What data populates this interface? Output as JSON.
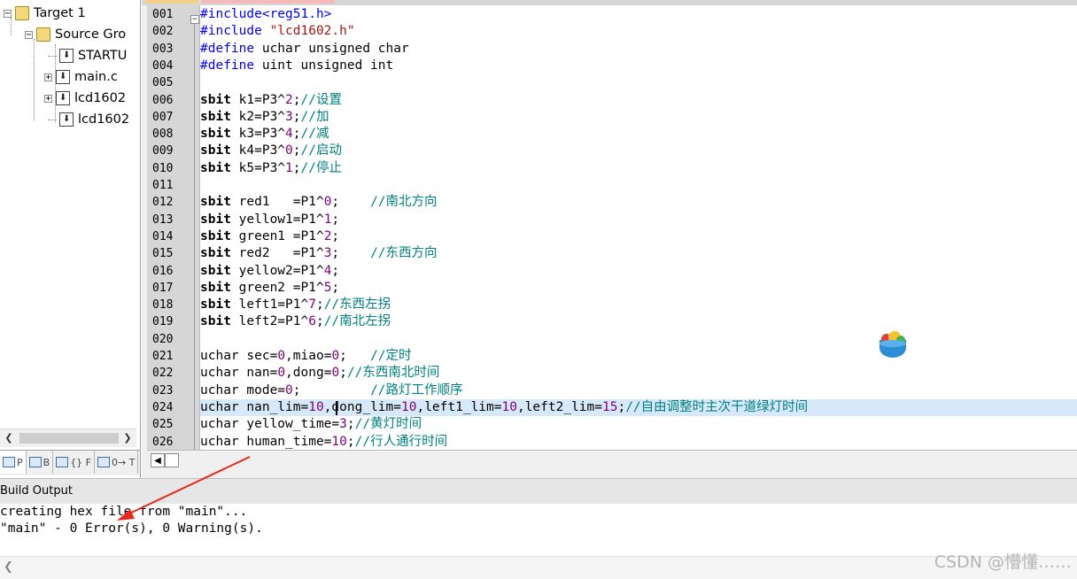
{
  "project": {
    "tree": [
      {
        "label": "Target 1",
        "expander": "−",
        "icon": "target-folder-icon"
      },
      {
        "label": "Source Gro",
        "expander": "−",
        "icon": "folder-icon"
      },
      {
        "label": "STARTU",
        "icon": "file-icon"
      },
      {
        "label": "main.c",
        "expander": "+",
        "icon": "file-icon"
      },
      {
        "label": "lcd1602",
        "expander": "+",
        "icon": "file-icon"
      },
      {
        "label": "lcd1602",
        "icon": "file-icon"
      }
    ],
    "tabs": [
      {
        "label": "P",
        "icon": "project-tab-icon"
      },
      {
        "label": "B",
        "icon": "books-tab-icon"
      },
      {
        "label": "{} F",
        "icon": "functions-tab-icon"
      },
      {
        "label": "0→ T",
        "icon": "templates-tab-icon"
      }
    ]
  },
  "editor": {
    "line_numbers": [
      "001",
      "002",
      "003",
      "004",
      "005",
      "006",
      "007",
      "008",
      "009",
      "010",
      "011",
      "012",
      "013",
      "014",
      "015",
      "016",
      "017",
      "018",
      "019",
      "020",
      "021",
      "022",
      "023",
      "024",
      "025",
      "026"
    ],
    "lines": [
      "#include<reg51.h>",
      "#include \"lcd1602.h\"",
      "#define uchar unsigned char",
      "#define uint unsigned int",
      "",
      "sbit k1=P3^2;//设置",
      "sbit k2=P3^3;//加",
      "sbit k3=P3^4;//减",
      "sbit k4=P3^0;//启动",
      "sbit k5=P3^1;//停止",
      "",
      "sbit red1   =P1^0;    //南北方向",
      "sbit yellow1=P1^1;",
      "sbit green1 =P1^2;",
      "sbit red2   =P1^3;    //东西方向",
      "sbit yellow2=P1^4;",
      "sbit green2 =P1^5;",
      "sbit left1=P1^7;//东西左拐",
      "sbit left2=P1^6;//南北左拐",
      "",
      "uchar sec=0,miao=0;   //定时",
      "uchar nan=0,dong=0;//东西南北时间",
      "uchar mode=0;         //路灯工作顺序",
      "uchar nan_lim=10,dong_lim=10,left1_lim=10,left2_lim=15;//自由调整时主次干道绿灯时间",
      "uchar yellow_time=3;//黄灯时间",
      "uchar human_time=10;//行人通行时间"
    ],
    "highlight_line": "024"
  },
  "build": {
    "title": "Build Output",
    "lines": [
      "creating hex file from \"main\"...",
      "\"main\" - 0 Error(s), 0 Warning(s)."
    ]
  },
  "watermark": "CSDN @懵懂……",
  "colors": {
    "keyword": "#000000",
    "preprocessor": "#0000ff",
    "number": "#7f007f",
    "string": "#a31515",
    "comment": "#008080",
    "arrow": "#e8281c",
    "highlight": "#d7e9f8"
  }
}
